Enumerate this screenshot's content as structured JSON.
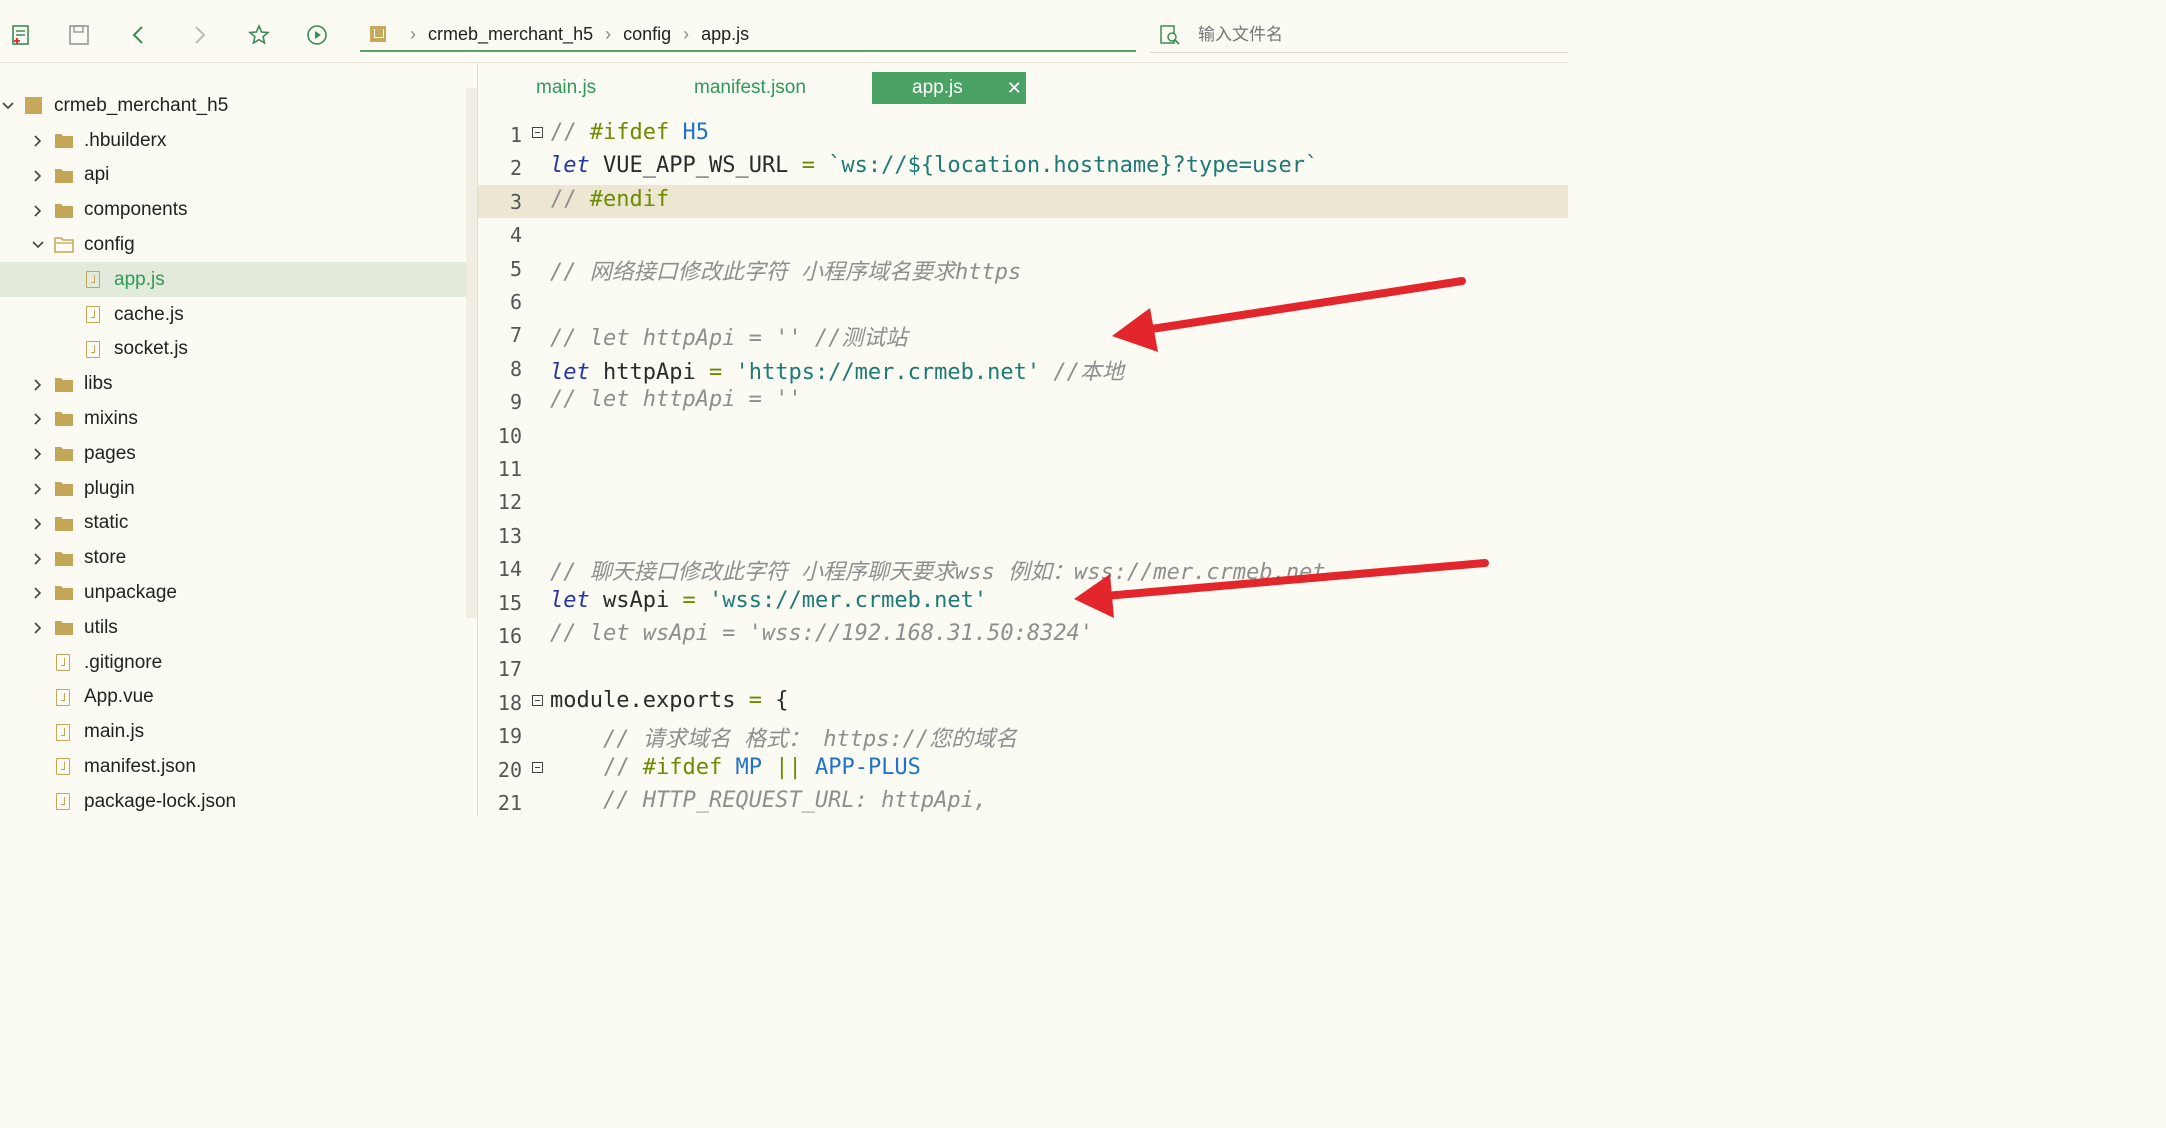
{
  "toolbar": {
    "breadcrumb": [
      "crmeb_merchant_h5",
      "config",
      "app.js"
    ],
    "search_placeholder": "输入文件名"
  },
  "sidebar": {
    "root": "crmeb_merchant_h5",
    "items": [
      {
        "label": ".hbuilderx",
        "type": "folder"
      },
      {
        "label": "api",
        "type": "folder"
      },
      {
        "label": "components",
        "type": "folder"
      },
      {
        "label": "config",
        "type": "folder-open"
      },
      {
        "label": "app.js",
        "type": "file",
        "selected": true
      },
      {
        "label": "cache.js",
        "type": "file"
      },
      {
        "label": "socket.js",
        "type": "file"
      },
      {
        "label": "libs",
        "type": "folder"
      },
      {
        "label": "mixins",
        "type": "folder"
      },
      {
        "label": "pages",
        "type": "folder"
      },
      {
        "label": "plugin",
        "type": "folder"
      },
      {
        "label": "static",
        "type": "folder"
      },
      {
        "label": "store",
        "type": "folder"
      },
      {
        "label": "unpackage",
        "type": "folder"
      },
      {
        "label": "utils",
        "type": "folder"
      },
      {
        "label": ".gitignore",
        "type": "file"
      },
      {
        "label": "App.vue",
        "type": "file"
      },
      {
        "label": "main.js",
        "type": "file"
      },
      {
        "label": "manifest.json",
        "type": "file"
      },
      {
        "label": "package-lock.json",
        "type": "file"
      }
    ]
  },
  "tabs": [
    {
      "label": "main.js",
      "active": false
    },
    {
      "label": "manifest.json",
      "active": false
    },
    {
      "label": "app.js",
      "active": true
    }
  ],
  "editor": {
    "lines": [
      {
        "n": "1",
        "code": "// #ifdef H5"
      },
      {
        "n": "2",
        "code": "let VUE_APP_WS_URL = `ws://${location.hostname}?type=user`"
      },
      {
        "n": "3",
        "code": "// #endif"
      },
      {
        "n": "4",
        "code": ""
      },
      {
        "n": "5",
        "code": "// 网络接口修改此字符 小程序域名要求https"
      },
      {
        "n": "6",
        "code": ""
      },
      {
        "n": "7",
        "code": "// let httpApi = '' //测试站"
      },
      {
        "n": "8",
        "code": "let httpApi = 'https://mer.crmeb.net' //本地"
      },
      {
        "n": "9",
        "code": "// let httpApi = ''"
      },
      {
        "n": "10",
        "code": ""
      },
      {
        "n": "11",
        "code": ""
      },
      {
        "n": "12",
        "code": ""
      },
      {
        "n": "13",
        "code": ""
      },
      {
        "n": "14",
        "code": "// 聊天接口修改此字符 小程序聊天要求wss 例如：wss://mer.crmeb.net"
      },
      {
        "n": "15",
        "code": "let wsApi = 'wss://mer.crmeb.net'"
      },
      {
        "n": "16",
        "code": "// let wsApi = 'wss://192.168.31.50:8324'"
      },
      {
        "n": "17",
        "code": ""
      },
      {
        "n": "18",
        "code": "module.exports = {"
      },
      {
        "n": "19",
        "code": "    // 请求域名 格式： https://您的域名"
      },
      {
        "n": "20",
        "code": "    // #ifdef MP || APP-PLUS"
      },
      {
        "n": "21",
        "code": "    // HTTP_REQUEST_URL: httpApi,"
      }
    ]
  },
  "colors": {
    "accent": "#4aa364",
    "arrow": "#e3262b"
  }
}
